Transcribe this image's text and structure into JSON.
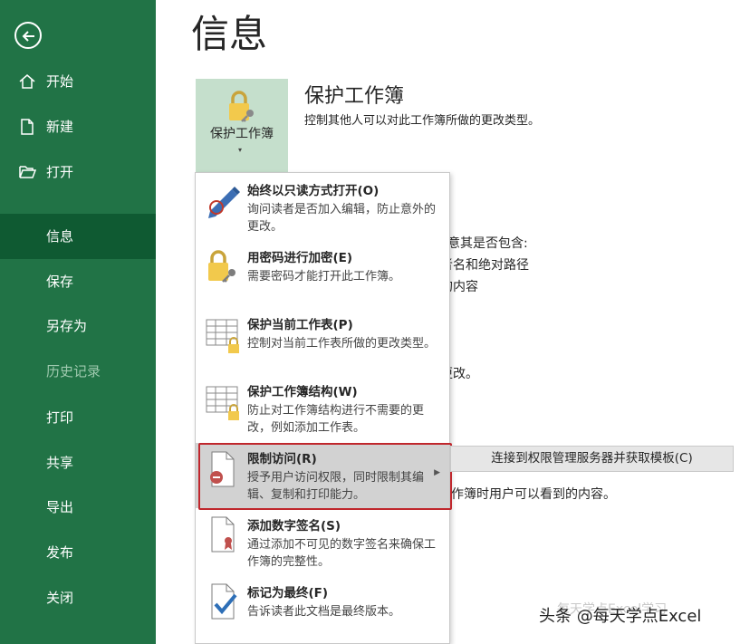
{
  "sidebar": {
    "items": [
      {
        "label": "开始",
        "icon": "home-icon"
      },
      {
        "label": "新建",
        "icon": "new-document-icon"
      },
      {
        "label": "打开",
        "icon": "folder-open-icon"
      },
      {
        "label": "信息",
        "active": true
      },
      {
        "label": "保存"
      },
      {
        "label": "另存为"
      },
      {
        "label": "历史记录",
        "disabled": true
      },
      {
        "label": "打印"
      },
      {
        "label": "共享"
      },
      {
        "label": "导出"
      },
      {
        "label": "发布"
      },
      {
        "label": "关闭"
      }
    ],
    "colors": {
      "background": "#217346",
      "active": "#0f5a32"
    }
  },
  "main": {
    "title": "信息",
    "protect_button": {
      "label": "保护工作簿",
      "caret": "▾"
    },
    "section_title": "保护工作簿",
    "section_desc": "控制其他人可以对此工作簿所做的更改类型。",
    "background_fragments": [
      "注意其是否包含:",
      "者名和绝对路径",
      "的内容",
      "更改。",
      "作簿时用户可以看到的内容。"
    ]
  },
  "menu": {
    "items": [
      {
        "title": "始终以只读方式打开(O)",
        "desc": "询问读者是否加入编辑，防止意外的更改。",
        "icon": "pencil-no-edit-icon"
      },
      {
        "title": "用密码进行加密(E)",
        "desc": "需要密码才能打开此工作簿。",
        "icon": "lock-key-icon"
      },
      {
        "title": "保护当前工作表(P)",
        "desc": "控制对当前工作表所做的更改类型。",
        "icon": "sheet-lock-icon"
      },
      {
        "title": "保护工作簿结构(W)",
        "desc": "防止对工作簿结构进行不需要的更改，例如添加工作表。",
        "icon": "workbook-lock-icon"
      },
      {
        "title": "限制访问(R)",
        "desc": "授予用户访问权限，同时限制其编辑、复制和打印能力。",
        "icon": "restrict-access-icon",
        "highlighted": true
      },
      {
        "title": "添加数字签名(S)",
        "desc": "通过添加不可见的数字签名来确保工作簿的完整性。",
        "icon": "digital-signature-icon"
      },
      {
        "title": "标记为最终(F)",
        "desc": "告诉读者此文档是最终版本。",
        "icon": "mark-final-icon"
      }
    ],
    "highlight_color": "#c0272d"
  },
  "submenu": {
    "label": "连接到权限管理服务器并获取模板(C)"
  },
  "watermark": {
    "text": "头条 @每天学点Excel",
    "ghost": "每天学点Excel学习"
  }
}
